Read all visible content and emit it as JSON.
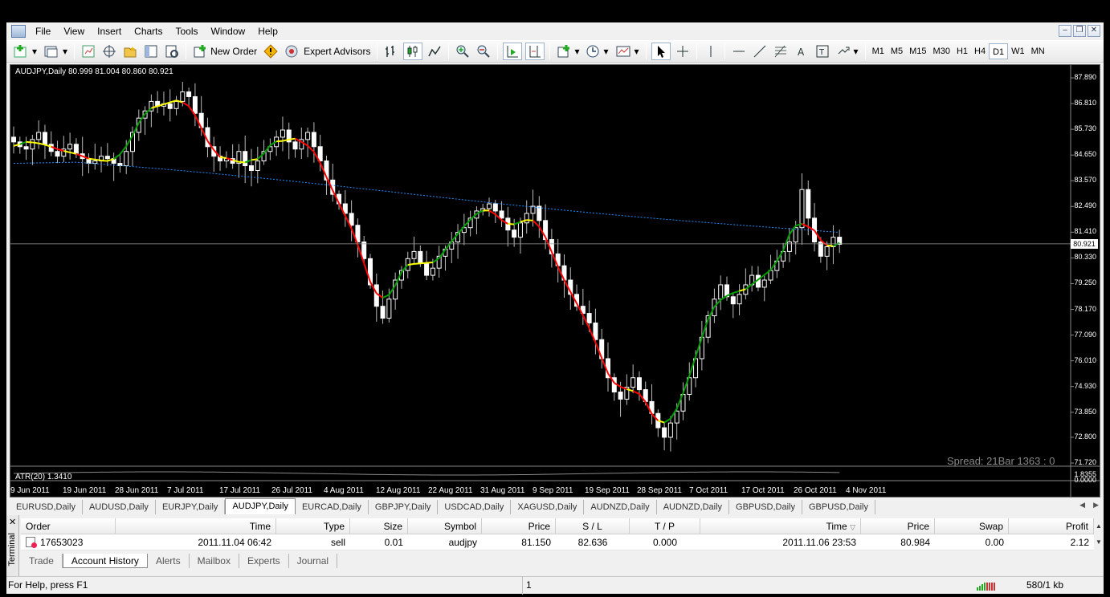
{
  "menu": [
    "File",
    "View",
    "Insert",
    "Charts",
    "Tools",
    "Window",
    "Help"
  ],
  "toolbar": {
    "new_order": "New Order",
    "expert_advisors": "Expert Advisors",
    "timeframes": [
      "M1",
      "M5",
      "M15",
      "M30",
      "H1",
      "H4",
      "D1",
      "W1",
      "MN"
    ],
    "active_timeframe": "D1"
  },
  "chart": {
    "title": "AUDJPY,Daily  80.999 81.004 80.860 80.921",
    "atr_label": "ATR(20) 1.3410",
    "spread_text": "Spread: 21Bar  1363 : 0",
    "current_price_label": "80.921",
    "atr_axis_top": "1.8355",
    "atr_axis_bottom": "0.0000",
    "colors": {
      "bull": "#ffffff",
      "bear": "#ffffff",
      "ma_up": "#00a000",
      "ma_down": "#ff0000",
      "ma_flat": "#ffff00",
      "long_ma": "#1e90ff",
      "background": "#000000"
    }
  },
  "chart_data": {
    "type": "candlestick",
    "symbol": "AUDJPY",
    "timeframe": "Daily",
    "y_ticks": [
      "87.890",
      "86.810",
      "85.730",
      "84.650",
      "83.570",
      "82.490",
      "81.410",
      "80.330",
      "79.250",
      "78.170",
      "77.090",
      "76.010",
      "74.930",
      "73.850",
      "72.800",
      "71.720"
    ],
    "ylim": [
      71.72,
      87.89
    ],
    "x_ticks": [
      "9 Jun 2011",
      "19 Jun 2011",
      "28 Jun 2011",
      "7 Jul 2011",
      "17 Jul 2011",
      "26 Jul 2011",
      "4 Aug 2011",
      "12 Aug 2011",
      "22 Aug 2011",
      "31 Aug 2011",
      "9 Sep 2011",
      "19 Sep 2011",
      "28 Sep 2011",
      "7 Oct 2011",
      "17 Oct 2011",
      "26 Oct 2011",
      "4 Nov 2011"
    ],
    "current_price": 80.921,
    "closes": [
      85.2,
      85.0,
      84.9,
      85.3,
      85.6,
      85.1,
      84.8,
      84.6,
      84.9,
      85.1,
      84.7,
      84.5,
      84.3,
      84.4,
      84.6,
      84.5,
      84.3,
      84.2,
      84.8,
      85.6,
      86.2,
      86.5,
      86.9,
      86.7,
      86.8,
      86.6,
      86.9,
      87.3,
      87.1,
      86.4,
      85.8,
      85.0,
      84.6,
      84.4,
      84.5,
      84.3,
      84.8,
      84.2,
      84.0,
      84.4,
      84.8,
      85.0,
      85.4,
      85.7,
      85.2,
      84.9,
      85.3,
      85.6,
      85.0,
      84.4,
      83.6,
      83.0,
      82.6,
      82.2,
      81.7,
      81.0,
      80.3,
      79.2,
      78.3,
      77.8,
      78.6,
      79.4,
      79.8,
      80.3,
      80.6,
      80.1,
      79.6,
      79.9,
      80.4,
      80.7,
      81.0,
      81.4,
      81.6,
      82.0,
      82.3,
      82.4,
      82.6,
      82.3,
      82.0,
      81.5,
      81.2,
      81.8,
      82.2,
      82.5,
      81.9,
      81.1,
      80.5,
      80.0,
      79.4,
      78.8,
      78.3,
      78.0,
      77.6,
      76.9,
      76.1,
      75.3,
      74.7,
      74.4,
      74.9,
      75.3,
      74.8,
      74.3,
      73.8,
      73.2,
      72.8,
      73.4,
      73.9,
      74.6,
      75.3,
      76.1,
      77.0,
      77.9,
      78.6,
      79.2,
      78.7,
      78.4,
      78.8,
      79.2,
      79.6,
      79.1,
      79.4,
      79.8,
      80.2,
      80.6,
      81.0,
      81.6,
      83.2,
      82.0,
      81.0,
      80.4,
      80.8,
      81.2,
      80.9
    ]
  },
  "symbol_tabs": [
    "EURUSD,Daily",
    "AUDUSD,Daily",
    "EURJPY,Daily",
    "AUDJPY,Daily",
    "EURCAD,Daily",
    "GBPJPY,Daily",
    "USDCAD,Daily",
    "XAGUSD,Daily",
    "AUDNZD,Daily",
    "AUDNZD,Daily",
    "GBPUSD,Daily",
    "GBPUSD,Daily"
  ],
  "active_symbol_tab": 3,
  "terminal": {
    "side_label": "Terminal",
    "columns": [
      "Order",
      "Time",
      "Type",
      "Size",
      "Symbol",
      "Price",
      "S / L",
      "T / P",
      "Time",
      "Price",
      "Swap",
      "Profit"
    ],
    "rows": [
      {
        "order": "17653023",
        "open_time": "2011.11.04 06:42",
        "type": "sell",
        "size": "0.01",
        "symbol": "audjpy",
        "price": "81.150",
        "sl": "82.636",
        "tp": "0.000",
        "close_time": "2011.11.06 23:53",
        "close_price": "80.984",
        "swap": "0.00",
        "profit": "2.12"
      }
    ],
    "tabs": [
      "Trade",
      "Account History",
      "Alerts",
      "Mailbox",
      "Experts",
      "Journal"
    ],
    "active_tab": 1
  },
  "status": {
    "help": "For Help, press F1",
    "profile": "1",
    "traffic": "580/1 kb"
  }
}
